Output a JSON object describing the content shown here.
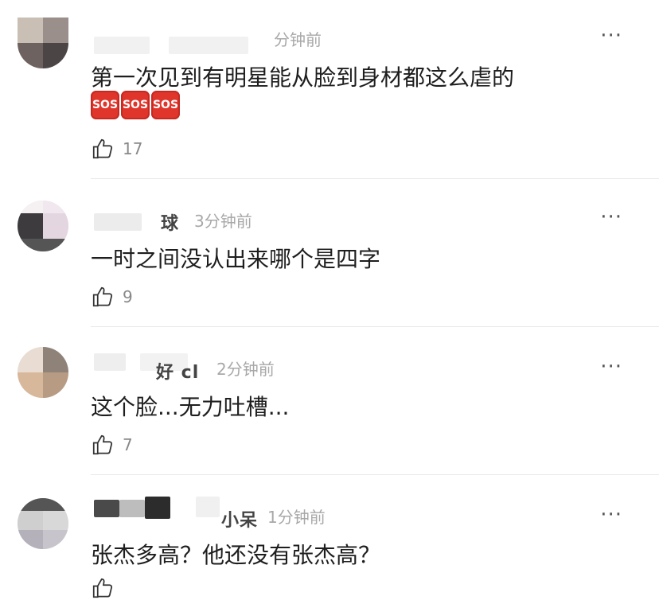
{
  "comments": [
    {
      "name_visible": "",
      "time": "分钟前",
      "text": "第一次见到有明星能从脸到身材都这么虐的",
      "emojis": [
        "SOS",
        "SOS",
        "SOS"
      ],
      "likes": "17",
      "more_icon": "···"
    },
    {
      "name_visible": "球",
      "time": "3分钟前",
      "text": "一时之间没认出来哪个是四字",
      "likes": "9",
      "more_icon": "···"
    },
    {
      "name_visible": "好 cl",
      "time": "2分钟前",
      "text": "这个脸...无力吐槽...",
      "likes": "7",
      "more_icon": "···"
    },
    {
      "name_visible": "小呆",
      "time": "1分钟前",
      "text": "张杰多高？他还没有张杰高？",
      "likes": "",
      "more_icon": "···"
    }
  ],
  "colors": {
    "sos_red": "#e0352b",
    "time_gray": "#a8a8a8",
    "divider": "#e9e9e9"
  }
}
